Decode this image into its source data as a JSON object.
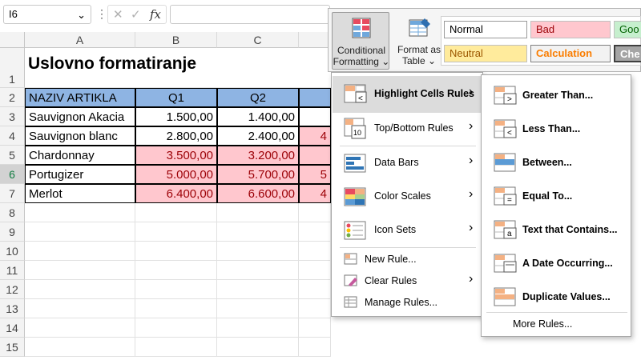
{
  "formula_bar": {
    "name_box": "I6",
    "menu_dots": "⋮",
    "cancel_glyph": "✕",
    "enter_glyph": "✓",
    "fx_glyph": "fx",
    "chevron": "⌄"
  },
  "columns": [
    "A",
    "B",
    "C"
  ],
  "rows": [
    "1",
    "2",
    "3",
    "4",
    "5",
    "6",
    "7",
    "8",
    "9",
    "10",
    "11",
    "12",
    "13",
    "14",
    "15"
  ],
  "sheet": {
    "title": "Uslovno formatiranje",
    "headers": [
      "NAZIV ARTIKLA",
      "Q1",
      "Q2"
    ],
    "items": [
      {
        "name": "Sauvignon Akacia",
        "q1": "1.500,00",
        "q2": "1.400,00",
        "q3_partial": ""
      },
      {
        "name": "Sauvignon blanc",
        "q1": "2.800,00",
        "q2": "2.400,00",
        "q3_partial": "4"
      },
      {
        "name": "Chardonnay",
        "q1": "3.500,00",
        "q2": "3.200,00",
        "q3_partial": ""
      },
      {
        "name": "Portugizer",
        "q1": "5.000,00",
        "q2": "5.700,00",
        "q3_partial": "5"
      },
      {
        "name": "Merlot",
        "q1": "6.400,00",
        "q2": "6.600,00",
        "q3_partial": "4"
      }
    ]
  },
  "ribbon": {
    "conditional_formatting": [
      "Conditional",
      "Formatting ⌄"
    ],
    "format_as_table": [
      "Format as",
      "Table ⌄"
    ],
    "styles": {
      "normal": "Normal",
      "bad": "Bad",
      "good": "Goo",
      "neutral": "Neutral",
      "calculation": "Calculation",
      "check": "Che"
    }
  },
  "cf_menu": {
    "highlight": "Highlight Cells Rules",
    "topbottom": "Top/Bottom Rules",
    "databars": "Data Bars",
    "colorscales": "Color Scales",
    "iconsets": "Icon Sets",
    "newrule": "New Rule...",
    "clearrules": "Clear Rules",
    "managerules": "Manage Rules...",
    "arrow": "›"
  },
  "submenu": {
    "greater": "Greater Than...",
    "less": "Less Than...",
    "between": "Between...",
    "equal": "Equal To...",
    "text": "Text that Contains...",
    "date": "A Date Occurring...",
    "duplicate": "Duplicate Values...",
    "more": "More Rules..."
  },
  "icon_glyphs": {
    "greater": ">",
    "less": "<",
    "equal": "=",
    "text": "a",
    "topbottom": "10"
  },
  "colors": {
    "header_blue": "#8eb4e3",
    "pink_fill": "#ffc7ce",
    "pink_text": "#9c0006",
    "menu_hover": "#dcdcdc"
  }
}
